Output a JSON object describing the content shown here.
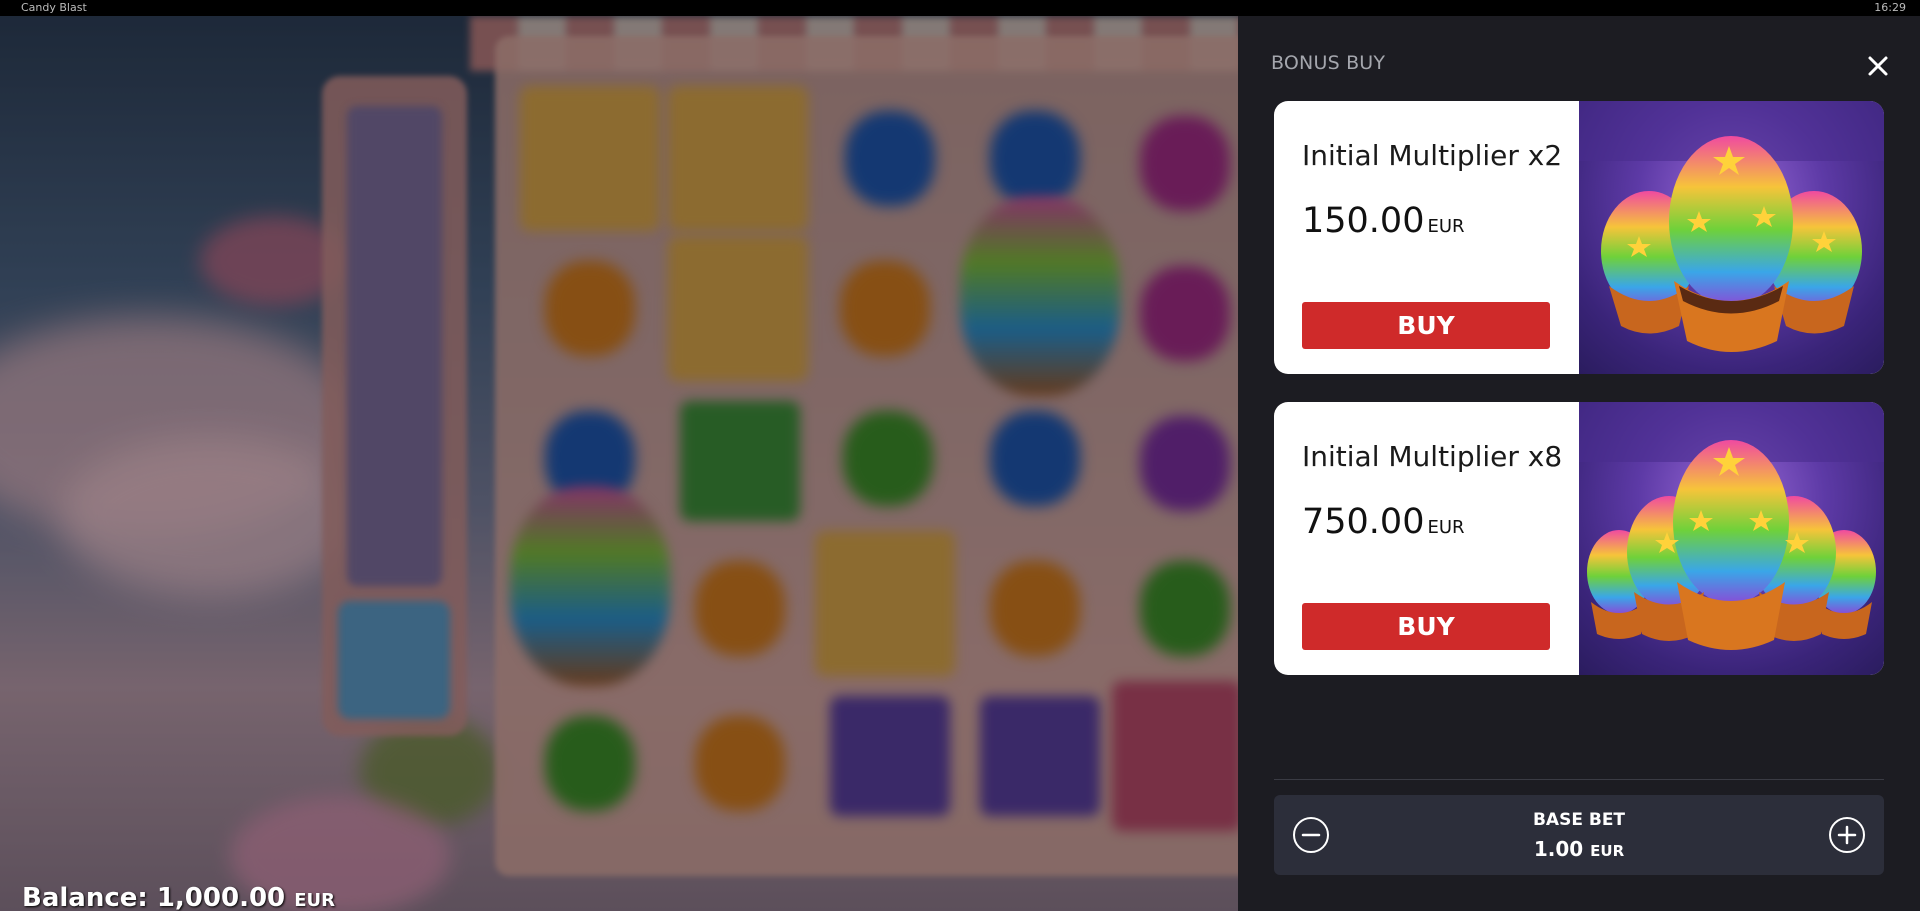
{
  "window": {
    "title": "Candy Blast",
    "time": "16:29"
  },
  "game": {
    "balance_label": "Balance:",
    "balance_value": "1,000.00",
    "balance_currency": "EUR"
  },
  "bonus_buy": {
    "title": "BONUS BUY",
    "close_icon": "close-icon",
    "options": [
      {
        "name": "Initial Multiplier x2",
        "price": "150.00",
        "currency": "EUR",
        "buy_label": "BUY",
        "art": "rainbow-cupcakes-3"
      },
      {
        "name": "Initial Multiplier x8",
        "price": "750.00",
        "currency": "EUR",
        "buy_label": "BUY",
        "art": "rainbow-cupcakes-5"
      }
    ],
    "base_bet": {
      "label": "BASE BET",
      "value": "1.00",
      "currency": "EUR",
      "decrease_icon": "minus-circle-icon",
      "increase_icon": "plus-circle-icon"
    }
  },
  "colors": {
    "panel_bg": "#1c1c22",
    "buy_button": "#cf2a2a",
    "bet_box": "#2c2e3a",
    "title_text": "#a4a6ad"
  }
}
